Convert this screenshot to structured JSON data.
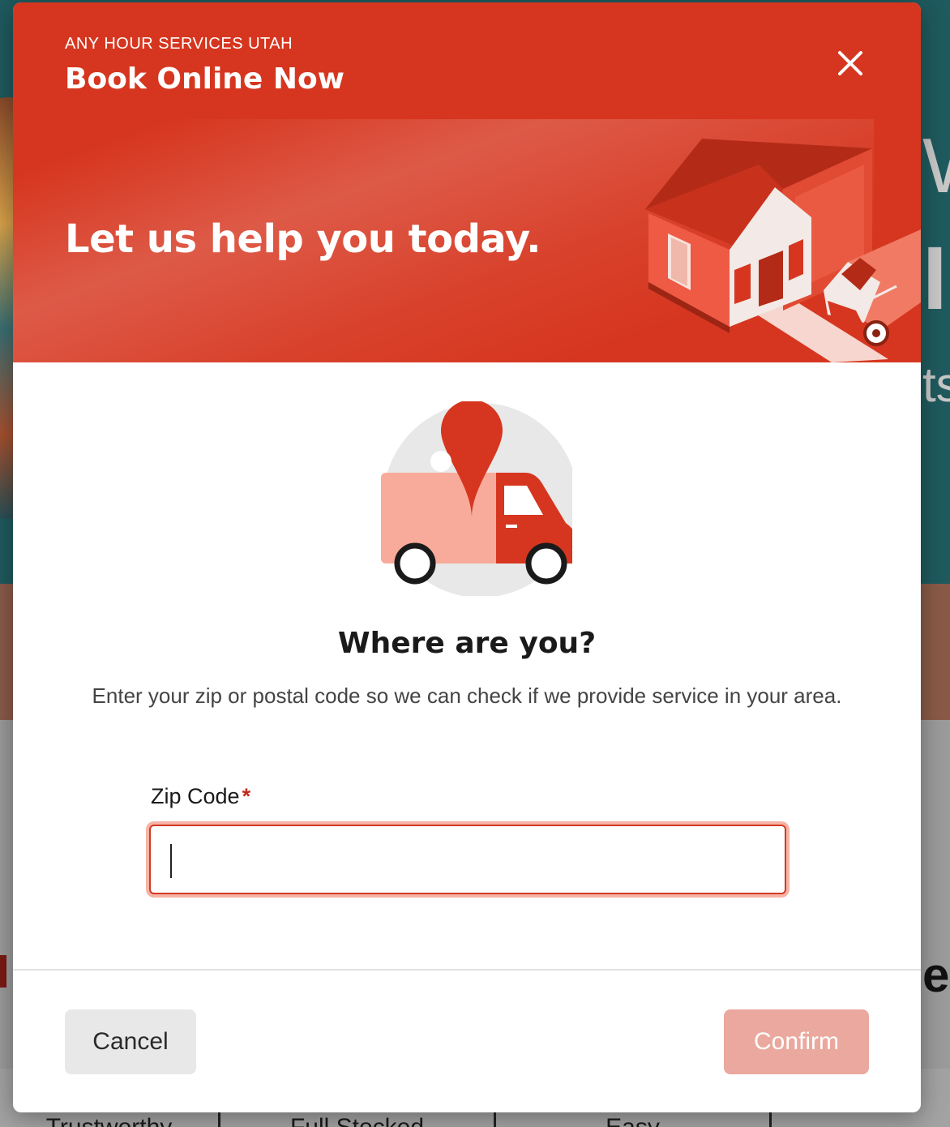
{
  "modal": {
    "eyebrow": "ANY HOUR SERVICES UTAH",
    "title": "Book Online Now",
    "headline": "Let us help you today.",
    "question": "Where are you?",
    "helper_text": "Enter your zip or postal code so we can check if we provide service in your area.",
    "zip_label": "Zip Code",
    "required_marker": "*",
    "zip_value": "",
    "cancel_label": "Cancel",
    "confirm_label": "Confirm",
    "close_icon": "close-icon"
  },
  "background": {
    "hero_text_fragments": [
      "W",
      "I",
      "ts"
    ],
    "section_fragment": "e",
    "features": [
      "Trustworthy",
      "Full Stocked",
      "Easy"
    ]
  },
  "colors": {
    "brand_red": "#d6361f",
    "confirm_disabled": "#eba89e",
    "cancel_bg": "#e8e8e8"
  }
}
